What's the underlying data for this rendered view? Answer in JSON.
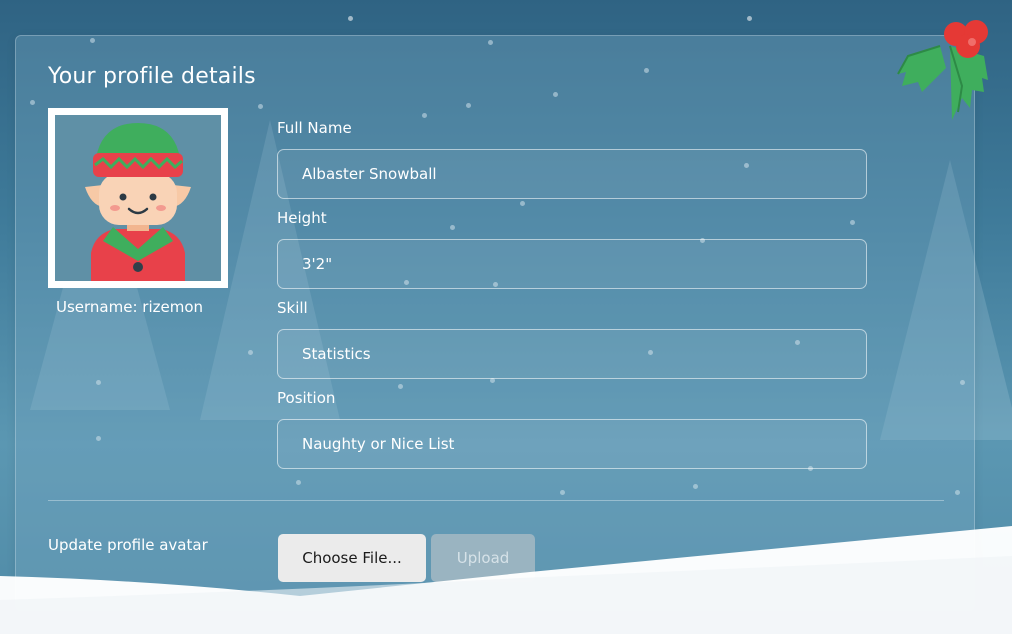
{
  "profile": {
    "title": "Your profile details",
    "username": "Username: rizemon"
  },
  "fields": [
    {
      "label": "Full Name",
      "value": "Albaster Snowball"
    },
    {
      "label": "Height",
      "value": "3'2\""
    },
    {
      "label": "Skill",
      "value": "Statistics"
    },
    {
      "label": "Position",
      "value": "Naughty or Nice List"
    }
  ],
  "avatar_upload": {
    "label": "Update profile avatar",
    "choose_label": "Choose File...",
    "upload_label": "Upload"
  },
  "icons": {
    "avatar": "elf-avatar-icon",
    "decoration": "holly-icon"
  }
}
